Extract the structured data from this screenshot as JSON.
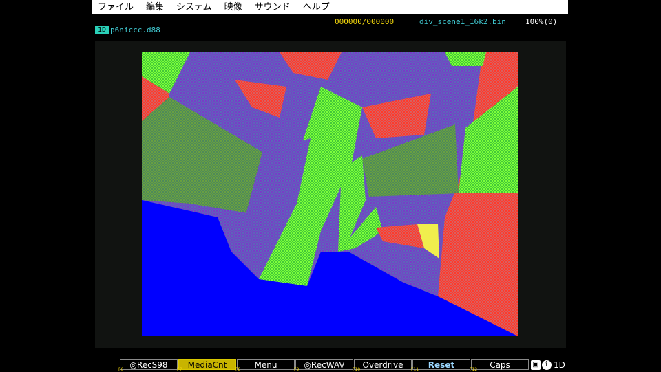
{
  "menu": [
    "ファイル",
    "編集",
    "システム",
    "映像",
    "サウンド",
    "ヘルプ"
  ],
  "status": {
    "counter": "000000/000000",
    "filename": "div_scene1_16k2.bin",
    "speed": "100%(0)",
    "drive_badge": "1D",
    "disk_name": "p6niccc.d88"
  },
  "fkeys": [
    {
      "label": "◎RecS98",
      "num": "F6"
    },
    {
      "label": "MediaCnt",
      "num": "F7"
    },
    {
      "label": "Menu",
      "num": "F8"
    },
    {
      "label": "◎RecWAV",
      "num": "F9"
    },
    {
      "label": "Overdrive",
      "num": "F10"
    },
    {
      "label": "Reset",
      "num": "F11"
    },
    {
      "label": "Caps",
      "num": "F12"
    }
  ],
  "tray": {
    "save_icon": "floppy-icon",
    "info_icon": "info-icon",
    "label": "1D"
  },
  "colors": {
    "floor": "#0000ff",
    "red": "#ff3a2a",
    "green": "#7dff3a",
    "purple": "#7a3ac8",
    "teal": "#2ad0b8",
    "yellow": "#ffff40"
  }
}
